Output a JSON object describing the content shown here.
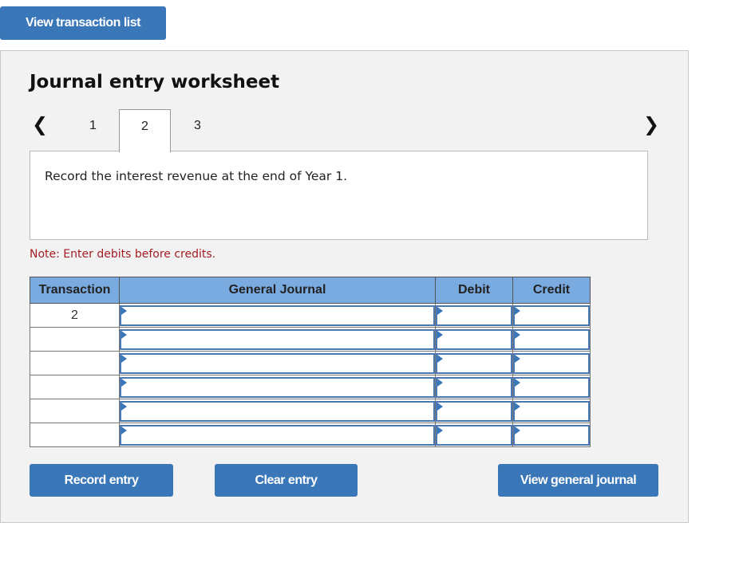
{
  "top_button": {
    "label": "View transaction list"
  },
  "worksheet": {
    "title": "Journal entry worksheet",
    "tabs": [
      {
        "label": "1",
        "active": false
      },
      {
        "label": "2",
        "active": true
      },
      {
        "label": "3",
        "active": false
      }
    ],
    "prev_icon": "chevron-left-icon",
    "next_icon": "chevron-right-icon",
    "description": "Record the interest revenue at the end of Year 1.",
    "note": "Note: Enter debits before credits.",
    "table": {
      "headers": [
        "Transaction",
        "General Journal",
        "Debit",
        "Credit"
      ],
      "rows": [
        {
          "transaction": "2",
          "account": "",
          "debit": "",
          "credit": ""
        },
        {
          "transaction": "",
          "account": "",
          "debit": "",
          "credit": ""
        },
        {
          "transaction": "",
          "account": "",
          "debit": "",
          "credit": ""
        },
        {
          "transaction": "",
          "account": "",
          "debit": "",
          "credit": ""
        },
        {
          "transaction": "",
          "account": "",
          "debit": "",
          "credit": ""
        },
        {
          "transaction": "",
          "account": "",
          "debit": "",
          "credit": ""
        }
      ]
    },
    "buttons": {
      "record": "Record entry",
      "clear": "Clear entry",
      "view_journal": "View general journal"
    }
  },
  "colors": {
    "button": "#3a77b9",
    "header": "#7aabe0",
    "note": "#a51c24"
  }
}
